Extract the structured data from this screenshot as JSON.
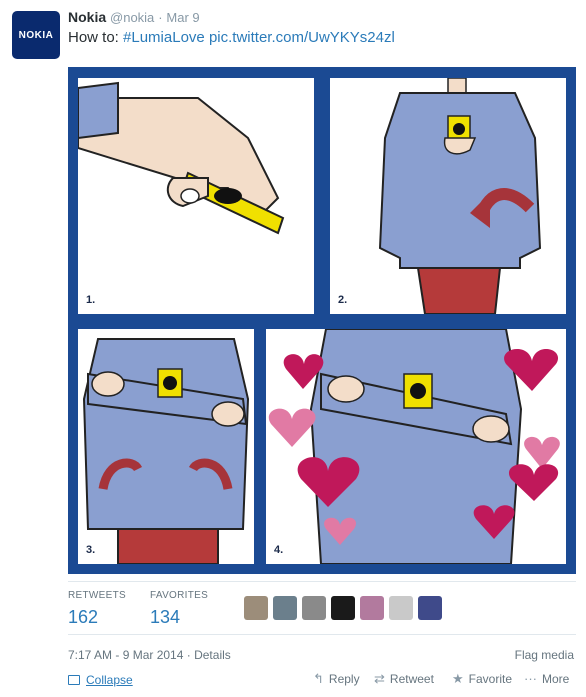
{
  "tweet": {
    "avatar_text": "NOKIA",
    "name": "Nokia",
    "handle": "@nokia",
    "date": "Mar 9",
    "text_prefix": "How to: ",
    "hashtag": "#LumiaLove",
    "link": "pic.twitter.com/UwYKYs24zl"
  },
  "media": {
    "panels": [
      {
        "number": "1."
      },
      {
        "number": "2."
      },
      {
        "number": "3."
      },
      {
        "number": "4."
      }
    ],
    "colors": {
      "border": "#1b4a93",
      "shirt": "#8a9fd0",
      "phone": "#f0e000",
      "arrow": "#a6343a",
      "pants": "#b53a3a",
      "heart_dark": "#c0185a",
      "heart_light": "#e17aa4"
    }
  },
  "stats": {
    "retweets_label": "RETWEETS",
    "retweets": "162",
    "favorites_label": "FAVORITES",
    "favorites": "134"
  },
  "meta": {
    "timestamp": "7:17 AM - 9 Mar 2014",
    "details": "Details",
    "flag": "Flag media"
  },
  "actions": {
    "collapse": "Collapse",
    "reply": "Reply",
    "retweet": "Retweet",
    "favorite": "Favorite",
    "more": "More"
  }
}
